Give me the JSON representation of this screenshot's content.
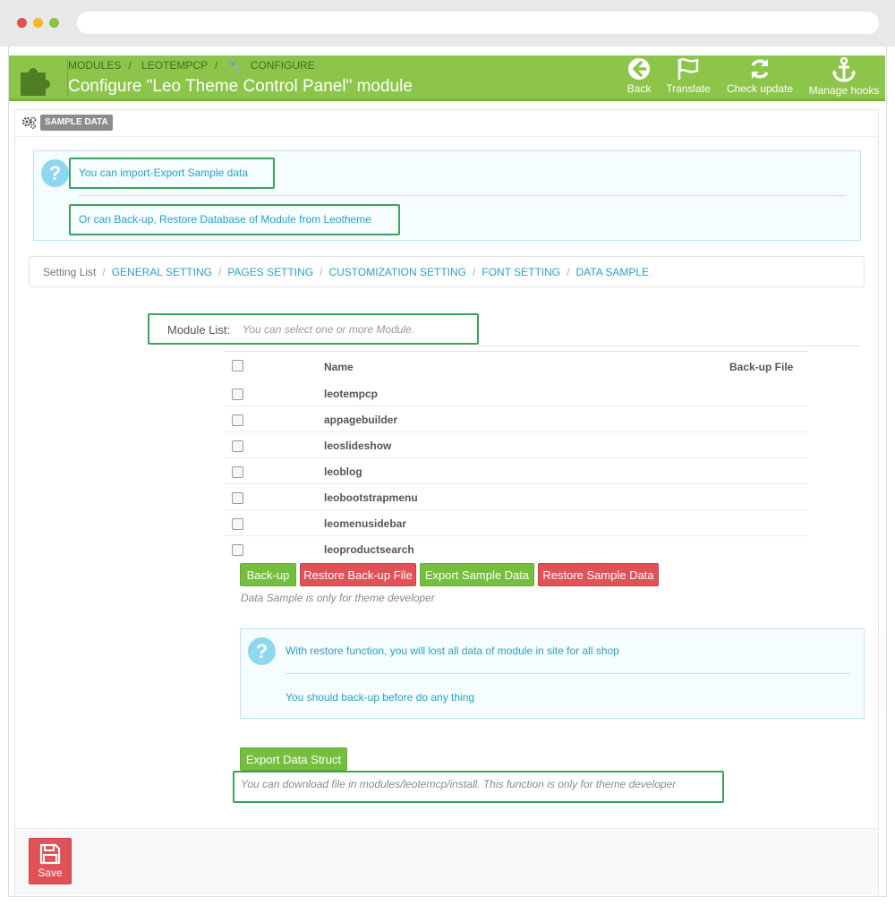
{
  "header": {
    "breadcrumb": [
      "MODULES",
      "LEOTEMPCP",
      "CONFIGURE"
    ],
    "title": "Configure \"Leo Theme Control Panel\" module",
    "actions": [
      {
        "label": "Back",
        "icon": "back-arrow-icon"
      },
      {
        "label": "Translate",
        "icon": "flag-icon"
      },
      {
        "label": "Check update",
        "icon": "refresh-icon"
      },
      {
        "label": "Manage hooks",
        "icon": "anchor-icon"
      }
    ],
    "accent_color": "#8dc54a"
  },
  "panel": {
    "heading_badge": "SAMPLE DATA"
  },
  "info_top": {
    "line1": "You can import-Export Sample data",
    "line2": "Or can Back-up, Restore Database of Module from Leotheme"
  },
  "tabs": {
    "current": "Setting List",
    "links": [
      "GENERAL SETTING",
      "PAGES SETTING",
      "CUSTOMIZATION SETTING",
      "FONT SETTING",
      "DATA SAMPLE"
    ]
  },
  "module_list": {
    "label": "Module List:",
    "help": "You can select one or more Module.",
    "columns": {
      "name": "Name",
      "backup": "Back-up File"
    },
    "modules": [
      "leotempcp",
      "appagebuilder",
      "leoslideshow",
      "leoblog",
      "leobootstrapmenu",
      "leomenusidebar",
      "leoproductsearch"
    ]
  },
  "actions": {
    "backup": "Back-up",
    "restore_backup": "Restore Back-up File",
    "export_sample": "Export Sample Data",
    "restore_sample": "Restore Sample Data",
    "note": "Data Sample is only for theme developer"
  },
  "info_restore": {
    "line1": "With restore function, you will lost all data of module in site for all shop",
    "line2": "You should back-up before do any thing"
  },
  "export_struct": {
    "button": "Export Data Struct",
    "note": "You can download file in modules/leotemcp/install. This function is only for theme developer"
  },
  "footer": {
    "save_label": "Save"
  },
  "colors": {
    "danger": "#e05257",
    "success": "#76bf3e",
    "info_text": "#2aa0c8"
  }
}
